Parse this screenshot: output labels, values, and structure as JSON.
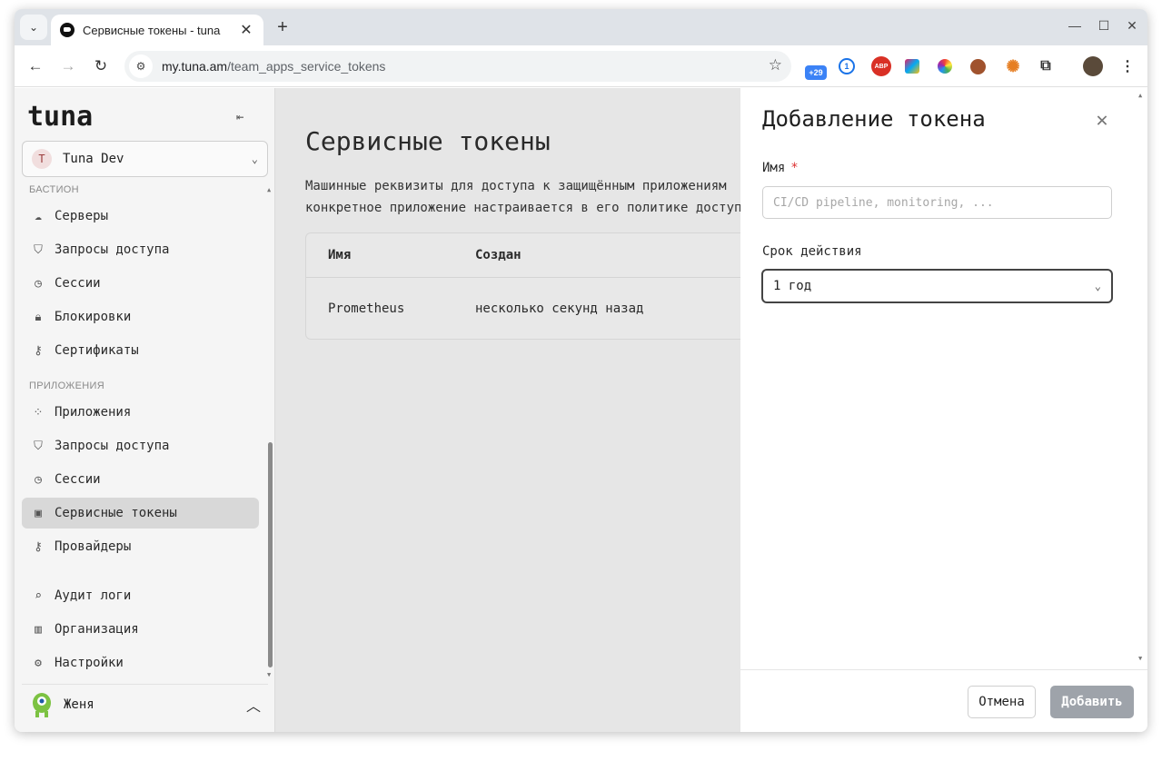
{
  "browser": {
    "tab_title": "Сервисные токены - tuna",
    "url_host": "my.tuna.am",
    "url_path": "/team_apps_service_tokens",
    "extension_badge": "+29",
    "abp_label": "ABP"
  },
  "sidebar": {
    "logo": "tuna",
    "team": {
      "initial": "T",
      "name": "Tuna Dev"
    },
    "sections": [
      {
        "title": "БАСТИОН",
        "items": [
          {
            "label": "Серверы",
            "icon": "cloud-icon"
          },
          {
            "label": "Запросы доступа",
            "icon": "shield-icon"
          },
          {
            "label": "Сессии",
            "icon": "clock-icon"
          },
          {
            "label": "Блокировки",
            "icon": "lock-icon"
          },
          {
            "label": "Сертификаты",
            "icon": "key-icon"
          }
        ]
      },
      {
        "title": "ПРИЛОЖЕНИЯ",
        "items": [
          {
            "label": "Приложения",
            "icon": "apps-icon"
          },
          {
            "label": "Запросы доступа",
            "icon": "shield-icon"
          },
          {
            "label": "Сессии",
            "icon": "clock-icon"
          },
          {
            "label": "Сервисные токены",
            "icon": "chip-icon",
            "active": true
          },
          {
            "label": "Провайдеры",
            "icon": "key-icon"
          }
        ]
      }
    ],
    "footer_items": [
      {
        "label": "Аудит логи",
        "icon": "search-icon"
      },
      {
        "label": "Организация",
        "icon": "building-icon"
      },
      {
        "label": "Настройки",
        "icon": "gear-icon"
      }
    ],
    "user": {
      "name": "Женя"
    }
  },
  "main": {
    "title": "Сервисные токены",
    "description_line1": "Машинные реквизиты для доступа к защищённым приложениям",
    "description_line2": "конкретное приложение настраивается в его политике доступа",
    "table": {
      "columns": [
        "Имя",
        "Создан"
      ],
      "rows": [
        {
          "name": "Prometheus",
          "created": "несколько секунд назад"
        }
      ]
    }
  },
  "drawer": {
    "title": "Добавление токена",
    "name_label": "Имя",
    "required_mark": "*",
    "name_value": "",
    "name_placeholder": "CI/CD pipeline, monitoring, ...",
    "expiry_label": "Срок действия",
    "expiry_value": "1 год",
    "cancel_label": "Отмена",
    "submit_label": "Добавить"
  },
  "colors": {
    "accent_disabled": "#9ea3aa",
    "active_nav": "#d8d8d8",
    "required": "#dd3333"
  }
}
